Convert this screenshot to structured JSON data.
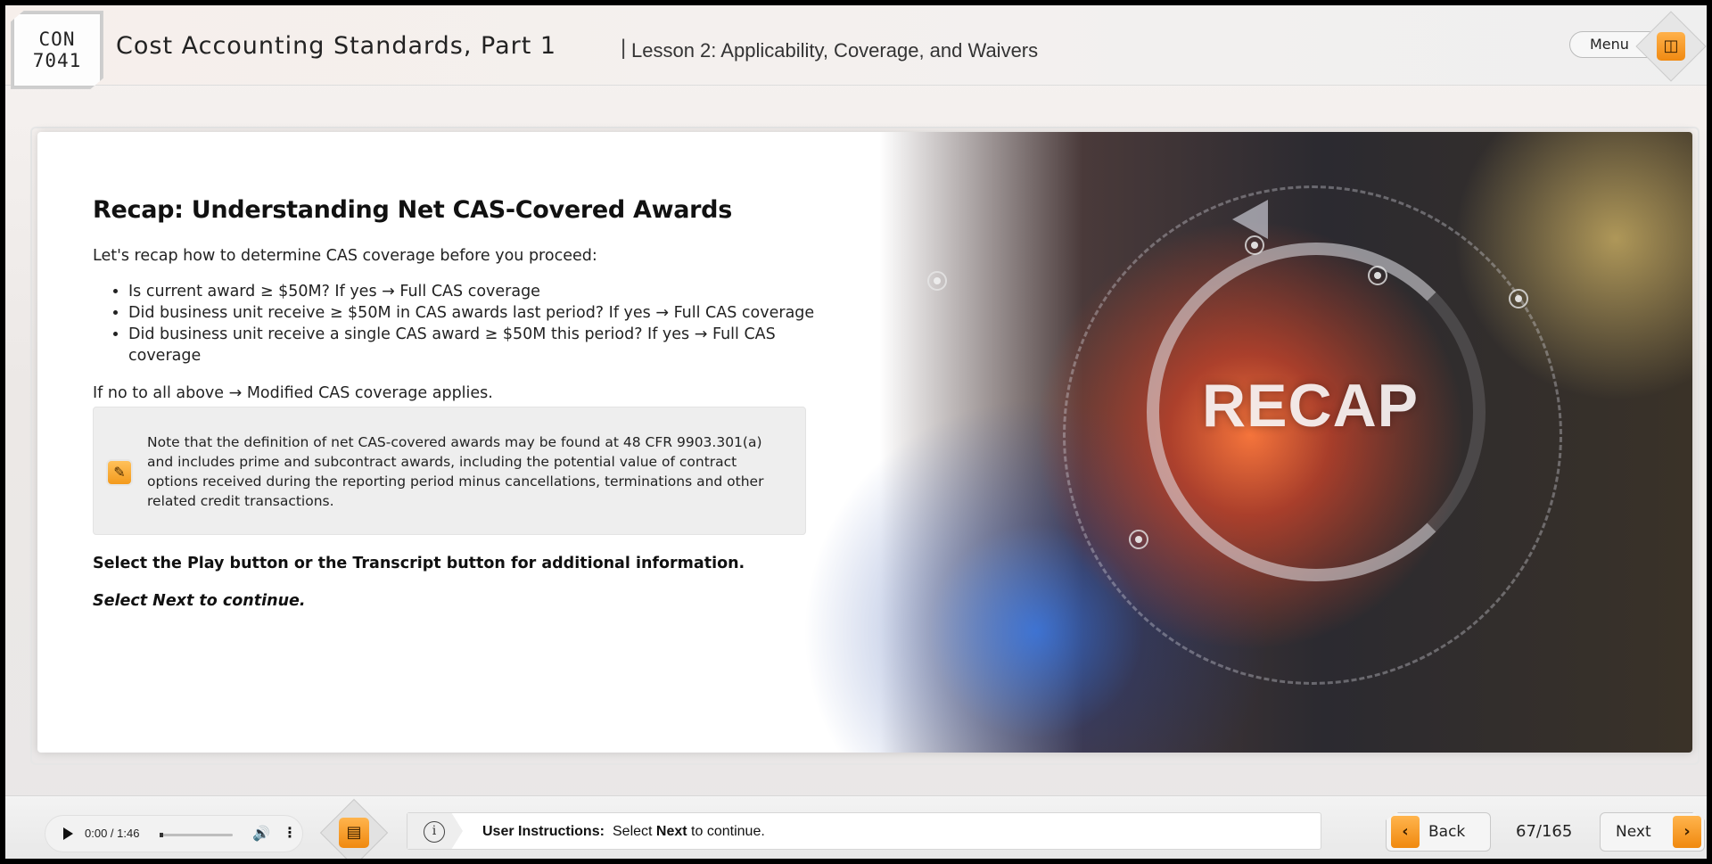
{
  "header": {
    "course_code_line1": "CON",
    "course_code_line2": "7041",
    "course_title": "Cost Accounting Standards, Part 1",
    "separator": "|",
    "lesson_title": "Lesson 2: Applicability, Coverage, and Waivers",
    "menu_label": "Menu",
    "menu_icon": "menu-grid-icon"
  },
  "content": {
    "heading": "Recap: Understanding Net CAS-Covered Awards",
    "intro": "Let's recap how to determine CAS coverage before you proceed:",
    "bullets": [
      "Is current award ≥ $50M? If yes → Full CAS coverage",
      "Did business unit receive ≥ $50M in CAS awards last period? If yes → Full CAS coverage",
      "Did business unit receive a single CAS award ≥ $50M this period? If yes → Full CAS coverage"
    ],
    "fallback": "If no to all above → Modified CAS coverage applies.",
    "note": "Note that the definition of net CAS-covered awards may be found at 48 CFR 9903.301(a) and includes prime and subcontract awards, including the potential value of contract options received during the reporting period minus cancellations, terminations and other related credit transactions.",
    "note_icon": "note-edit-icon",
    "instruction_primary": "Select the Play button or the Transcript button for additional information.",
    "instruction_secondary": "Select Next to continue.",
    "hero_word": "RECAP"
  },
  "footer": {
    "audio_time": "0:00 / 1:46",
    "audio_progress": 0.0,
    "transcript_icon": "transcript-icon",
    "instructions_label": "User Instructions:",
    "instructions_pre": "Select ",
    "instructions_bold": "Next",
    "instructions_post": " to continue.",
    "back_label": "Back",
    "page_indicator": "67/165",
    "next_label": "Next"
  },
  "colors": {
    "accent_orange": "#f39a1c",
    "text_dark": "#222222"
  }
}
